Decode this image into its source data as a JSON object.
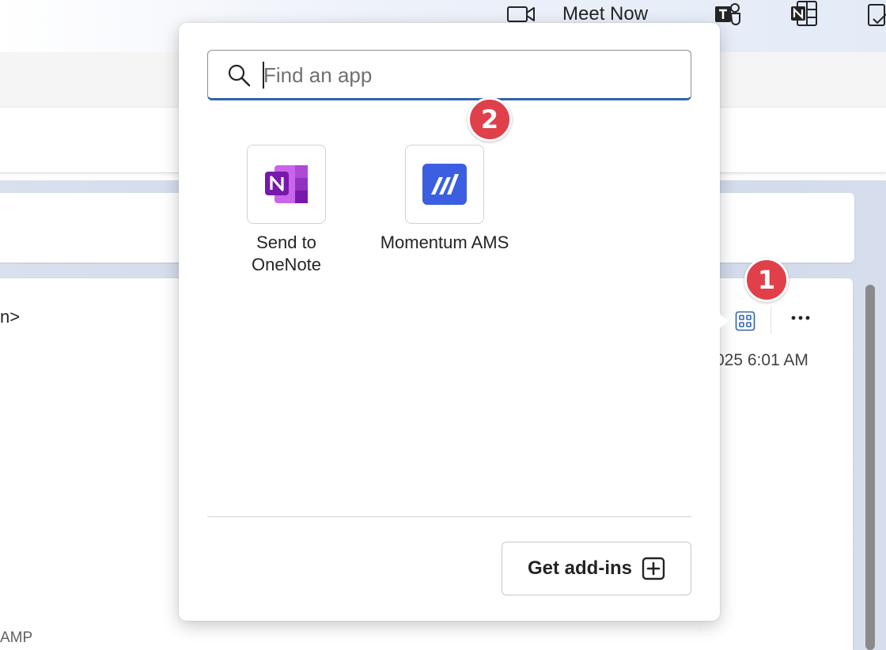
{
  "header": {
    "meet_now_label": "Meet Now",
    "icons": [
      "video-camera-icon",
      "teams-icon",
      "onenote-icon",
      "todo-icon"
    ]
  },
  "message": {
    "sender_fragment": "n>",
    "timestamp_fragment": "025 6:01 AM",
    "footer_fragment": "AMP"
  },
  "popup": {
    "search": {
      "placeholder": "Find an app",
      "value": ""
    },
    "apps": [
      {
        "label": "Send to\nOneNote",
        "icon": "onenote-icon"
      },
      {
        "label": "Momentum AMS",
        "icon": "momentum-ams-icon"
      }
    ],
    "get_addins_label": "Get add-ins"
  },
  "badges": {
    "step_1": "1",
    "step_2": "2"
  },
  "colors": {
    "accent": "#3163b0",
    "badge": "#e0404a",
    "onenote": "#7b3fbf",
    "momentum": "#3b5fe0"
  }
}
